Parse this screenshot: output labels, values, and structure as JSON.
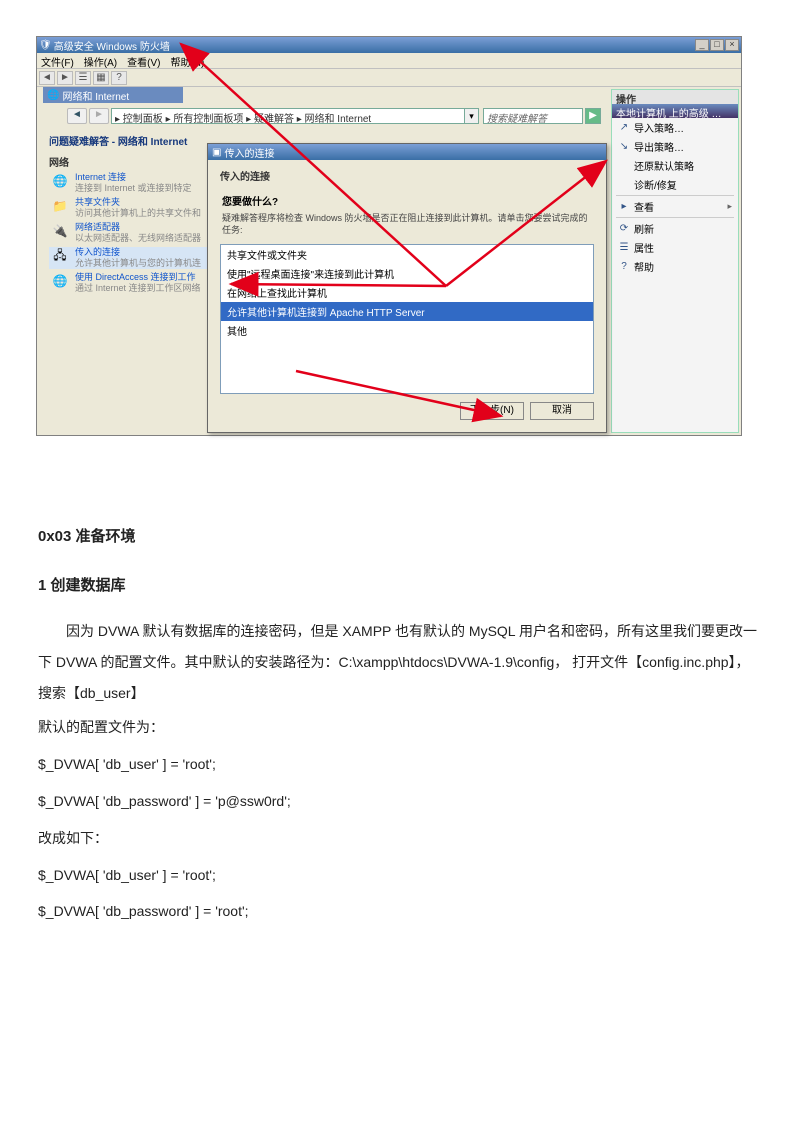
{
  "window": {
    "title": "高级安全 Windows 防火墙",
    "menus": [
      "文件(F)",
      "操作(A)",
      "查看(V)",
      "帮助(H)"
    ],
    "subtab": "网络和 Internet",
    "breadcrumb": "▸ 控制面板 ▸ 所有控制面板项 ▸ 疑难解答 ▸ 网络和 Internet",
    "search_placeholder": "搜索疑难解答"
  },
  "leftpanel": {
    "heading": "问题疑难解答 - 网络和 Internet",
    "section": "网络",
    "items": [
      {
        "title": "Internet 连接",
        "sub": "连接到 Internet 或连接到特定"
      },
      {
        "title": "共享文件夹",
        "sub": "访问其他计算机上的共享文件和"
      },
      {
        "title": "网络适配器",
        "sub": "以太网适配器、无线网络适配器"
      },
      {
        "title": "传入的连接",
        "sub": "允许其他计算机与您的计算机连"
      },
      {
        "title": "使用 DirectAccess 连接到工作",
        "sub": "通过 Internet 连接到工作区网络"
      }
    ]
  },
  "dialog": {
    "title": "传入的连接",
    "subtitle": "传入的连接",
    "question": "您要做什么?",
    "desc": "疑难解答程序将检查 Windows 防火墙是否正在阻止连接到此计算机。请单击您要尝试完成的任务:",
    "options": [
      "共享文件或文件夹",
      "使用\"远程桌面连接\"来连接到此计算机",
      "在网络上查找此计算机",
      "允许其他计算机连接到 Apache HTTP Server",
      "其他"
    ],
    "selected_index": 3,
    "buttons": {
      "next": "下一步(N)",
      "cancel": "取消"
    }
  },
  "actions": {
    "title": "操作",
    "header": "本地计算机 上的高级 …",
    "items": [
      {
        "icon": "↗",
        "label": "导入策略…"
      },
      {
        "icon": "↘",
        "label": "导出策略…"
      },
      {
        "icon": " ",
        "label": "还原默认策略"
      },
      {
        "icon": " ",
        "label": "诊断/修复"
      },
      {
        "icon": "▸",
        "label": "查看"
      },
      {
        "icon": "⟳",
        "label": "刷新"
      },
      {
        "icon": "☰",
        "label": "属性"
      },
      {
        "icon": "?",
        "label": "帮助"
      }
    ]
  },
  "document": {
    "h2": "0x03  准备环境",
    "h3": "1  创建数据库",
    "p1": "因为 DVWA 默认有数据库的连接密码，但是 XAMPP 也有默认的 MySQL 用户名和密码，所有这里我们要更改一下 DVWA 的配置文件。其中默认的安装路径为：C:\\xampp\\htdocs\\DVWA-1.9\\config，   打开文件【config.inc.php】，搜索【db_user】",
    "p2": "默认的配置文件为：",
    "c1": "$_DVWA[ 'db_user' ]      = 'root';",
    "c2": "$_DVWA[ 'db_password' ] = 'p@ssw0rd';",
    "p3": "改成如下：",
    "c3": "$_DVWA[ 'db_user' ]      = 'root';",
    "c4": "$_DVWA[ 'db_password' ] = 'root';"
  }
}
